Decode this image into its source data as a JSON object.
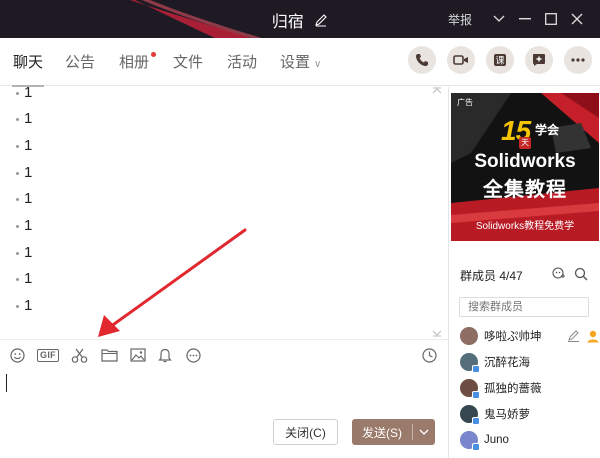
{
  "window": {
    "title": "归宿",
    "report_label": "举报"
  },
  "tabs": [
    {
      "label": "聊天",
      "active": true
    },
    {
      "label": "公告"
    },
    {
      "label": "相册",
      "badge": true
    },
    {
      "label": "文件"
    },
    {
      "label": "活动"
    },
    {
      "label": "设置"
    }
  ],
  "header_actions": [
    "phone-icon",
    "video-icon",
    "course-icon",
    "add-app-icon",
    "more-icon"
  ],
  "messages": [
    "1",
    "1",
    "1",
    "1",
    "1",
    "1",
    "1",
    "1",
    "1"
  ],
  "toolbar": {
    "gif_label": "GIF",
    "icons": [
      "emoji-icon",
      "gif-icon",
      "scissors-icon",
      "folder-icon",
      "image-icon",
      "bell-icon",
      "more-dots-icon",
      "history-clock-icon"
    ]
  },
  "input": {
    "close_label": "关闭(C)",
    "send_label": "发送(S)"
  },
  "ad": {
    "tag": "广告",
    "number": "15",
    "day": "天",
    "learn": "学会",
    "product": "Solidworks",
    "headline": "全集教程",
    "subline": "Solidworks教程免费学"
  },
  "members": {
    "heading": "群成员 4/47",
    "search_placeholder": "搜索群成员",
    "list": [
      {
        "name": "哆啦ぷ帅坤",
        "color": "#8d6e63"
      },
      {
        "name": "沉醉花海",
        "color": "#546e7a"
      },
      {
        "name": "孤独的蔷薇",
        "color": "#6d4c41"
      },
      {
        "name": "鬼马娇萝",
        "color": "#37474f"
      },
      {
        "name": "Juno",
        "color": "#7986cb"
      }
    ]
  },
  "colors": {
    "titlebar": "#1e1a24",
    "accent_send": "#9a7a6a",
    "action_bg": "#e9e4e0",
    "arrow_red": "#e0282e"
  }
}
